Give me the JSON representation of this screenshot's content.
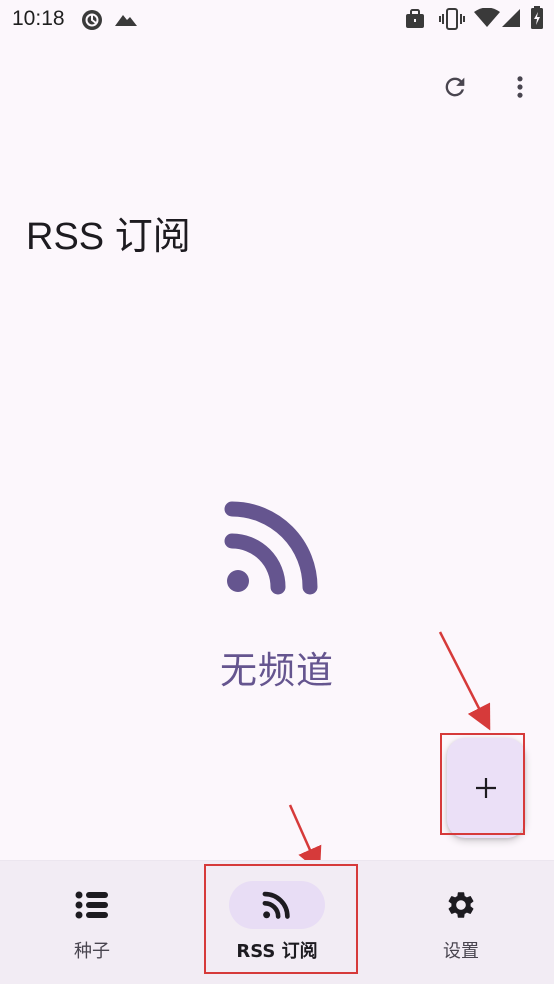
{
  "status_bar": {
    "time": "10:18",
    "icons": [
      "sync-icon",
      "mountain-icon",
      "briefcase-icon",
      "vibrate-icon",
      "wifi-icon",
      "signal-icon",
      "battery-icon"
    ]
  },
  "app_bar": {
    "title": "RSS 订阅",
    "actions": [
      "refresh-icon",
      "more-vert-icon"
    ]
  },
  "empty_state": {
    "icon": "rss-feed-icon",
    "message": "无频道"
  },
  "fab": {
    "icon": "add-icon",
    "label": "+"
  },
  "bottom_nav": {
    "items": [
      {
        "label": "种子",
        "icon": "list-icon",
        "active": false
      },
      {
        "label": "RSS 订阅",
        "icon": "rss-feed-icon",
        "active": true
      },
      {
        "label": "设置",
        "icon": "gear-icon",
        "active": false
      }
    ]
  },
  "colors": {
    "background": "#fcf7fc",
    "accent": "#65558f",
    "nav_background": "#f2ecf4",
    "nav_active_indicator": "#e8ddf5",
    "fab_background": "#ebe0f7",
    "annotation": "#d63a3a"
  }
}
